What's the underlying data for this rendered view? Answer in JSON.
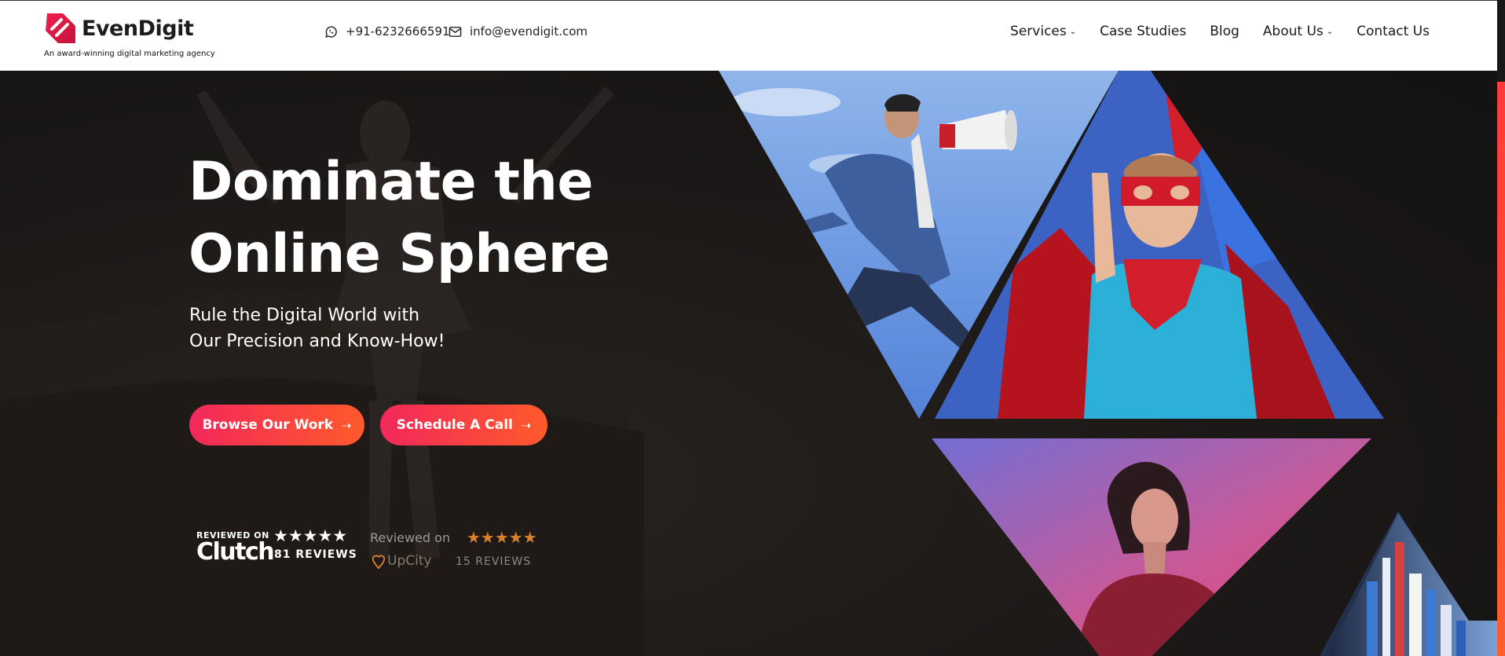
{
  "brand": {
    "name": "EvenDigit",
    "tagline": "An award-winning digital marketing agency",
    "accent_color": "#e8194f"
  },
  "contact": {
    "phone": "+91-6232666591",
    "email": "info@evendigit.com"
  },
  "nav": {
    "items": [
      {
        "label": "Services",
        "has_dropdown": true
      },
      {
        "label": "Case Studies",
        "has_dropdown": false
      },
      {
        "label": "Blog",
        "has_dropdown": false
      },
      {
        "label": "About Us",
        "has_dropdown": true
      },
      {
        "label": "Contact Us",
        "has_dropdown": false
      }
    ]
  },
  "hero": {
    "headline_line1": "Dominate the",
    "headline_line2": "Online Sphere",
    "subhead_line1": "Rule the Digital World with",
    "subhead_line2": "Our Precision and Know-How!",
    "primary_button": "Browse Our Work",
    "secondary_button": "Schedule A Call"
  },
  "reviews": {
    "clutch": {
      "label": "REVIEWED ON",
      "brand": "Clutch",
      "stars": "★★★★★",
      "count": "81 REVIEWS"
    },
    "upcity": {
      "label": "Reviewed on",
      "brand": "UpCity",
      "stars": "★★★★★",
      "count": "15 REVIEWS"
    }
  },
  "icons": {
    "phone": "whatsapp-icon",
    "email": "mail-icon",
    "arrow": "arrow-right-icon"
  }
}
